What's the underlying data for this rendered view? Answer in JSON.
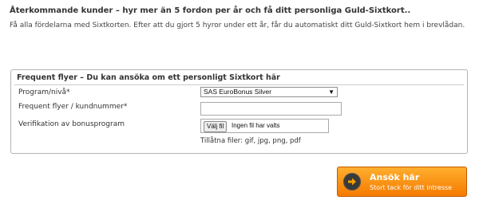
{
  "header": {
    "heading": "Återkommande kunder – hyr mer än 5 fordon per år och få ditt personliga Guld-Sixtkort..",
    "intro": "Få alla fördelarna med Sixtkorten. Efter att du gjort 5 hyror under ett år, får du automatiskt ditt Guld-Sixtkort hem i brevlådan."
  },
  "frequent_flyer": {
    "title": "Frequent flyer – Du kan ansöka om ett personligt Sixtkort här",
    "program_label": "Program/nivå*",
    "program_value": "SAS EuroBonus Silver",
    "number_label": "Frequent flyer / kundnummer*",
    "number_value": "",
    "verification_label": "Verifikation av bonusprogram",
    "file_button": "Välj fil",
    "file_status": "Ingen fil har valts",
    "allowed_files": "Tillåtna filer: gif, jpg, png, pdf"
  },
  "apply_button": {
    "title": "Ansök här",
    "subtitle": "Stort tack för ditt intresse"
  },
  "colors": {
    "button_orange": "#f57b00",
    "arrow_circle": "#3a3a3a"
  }
}
